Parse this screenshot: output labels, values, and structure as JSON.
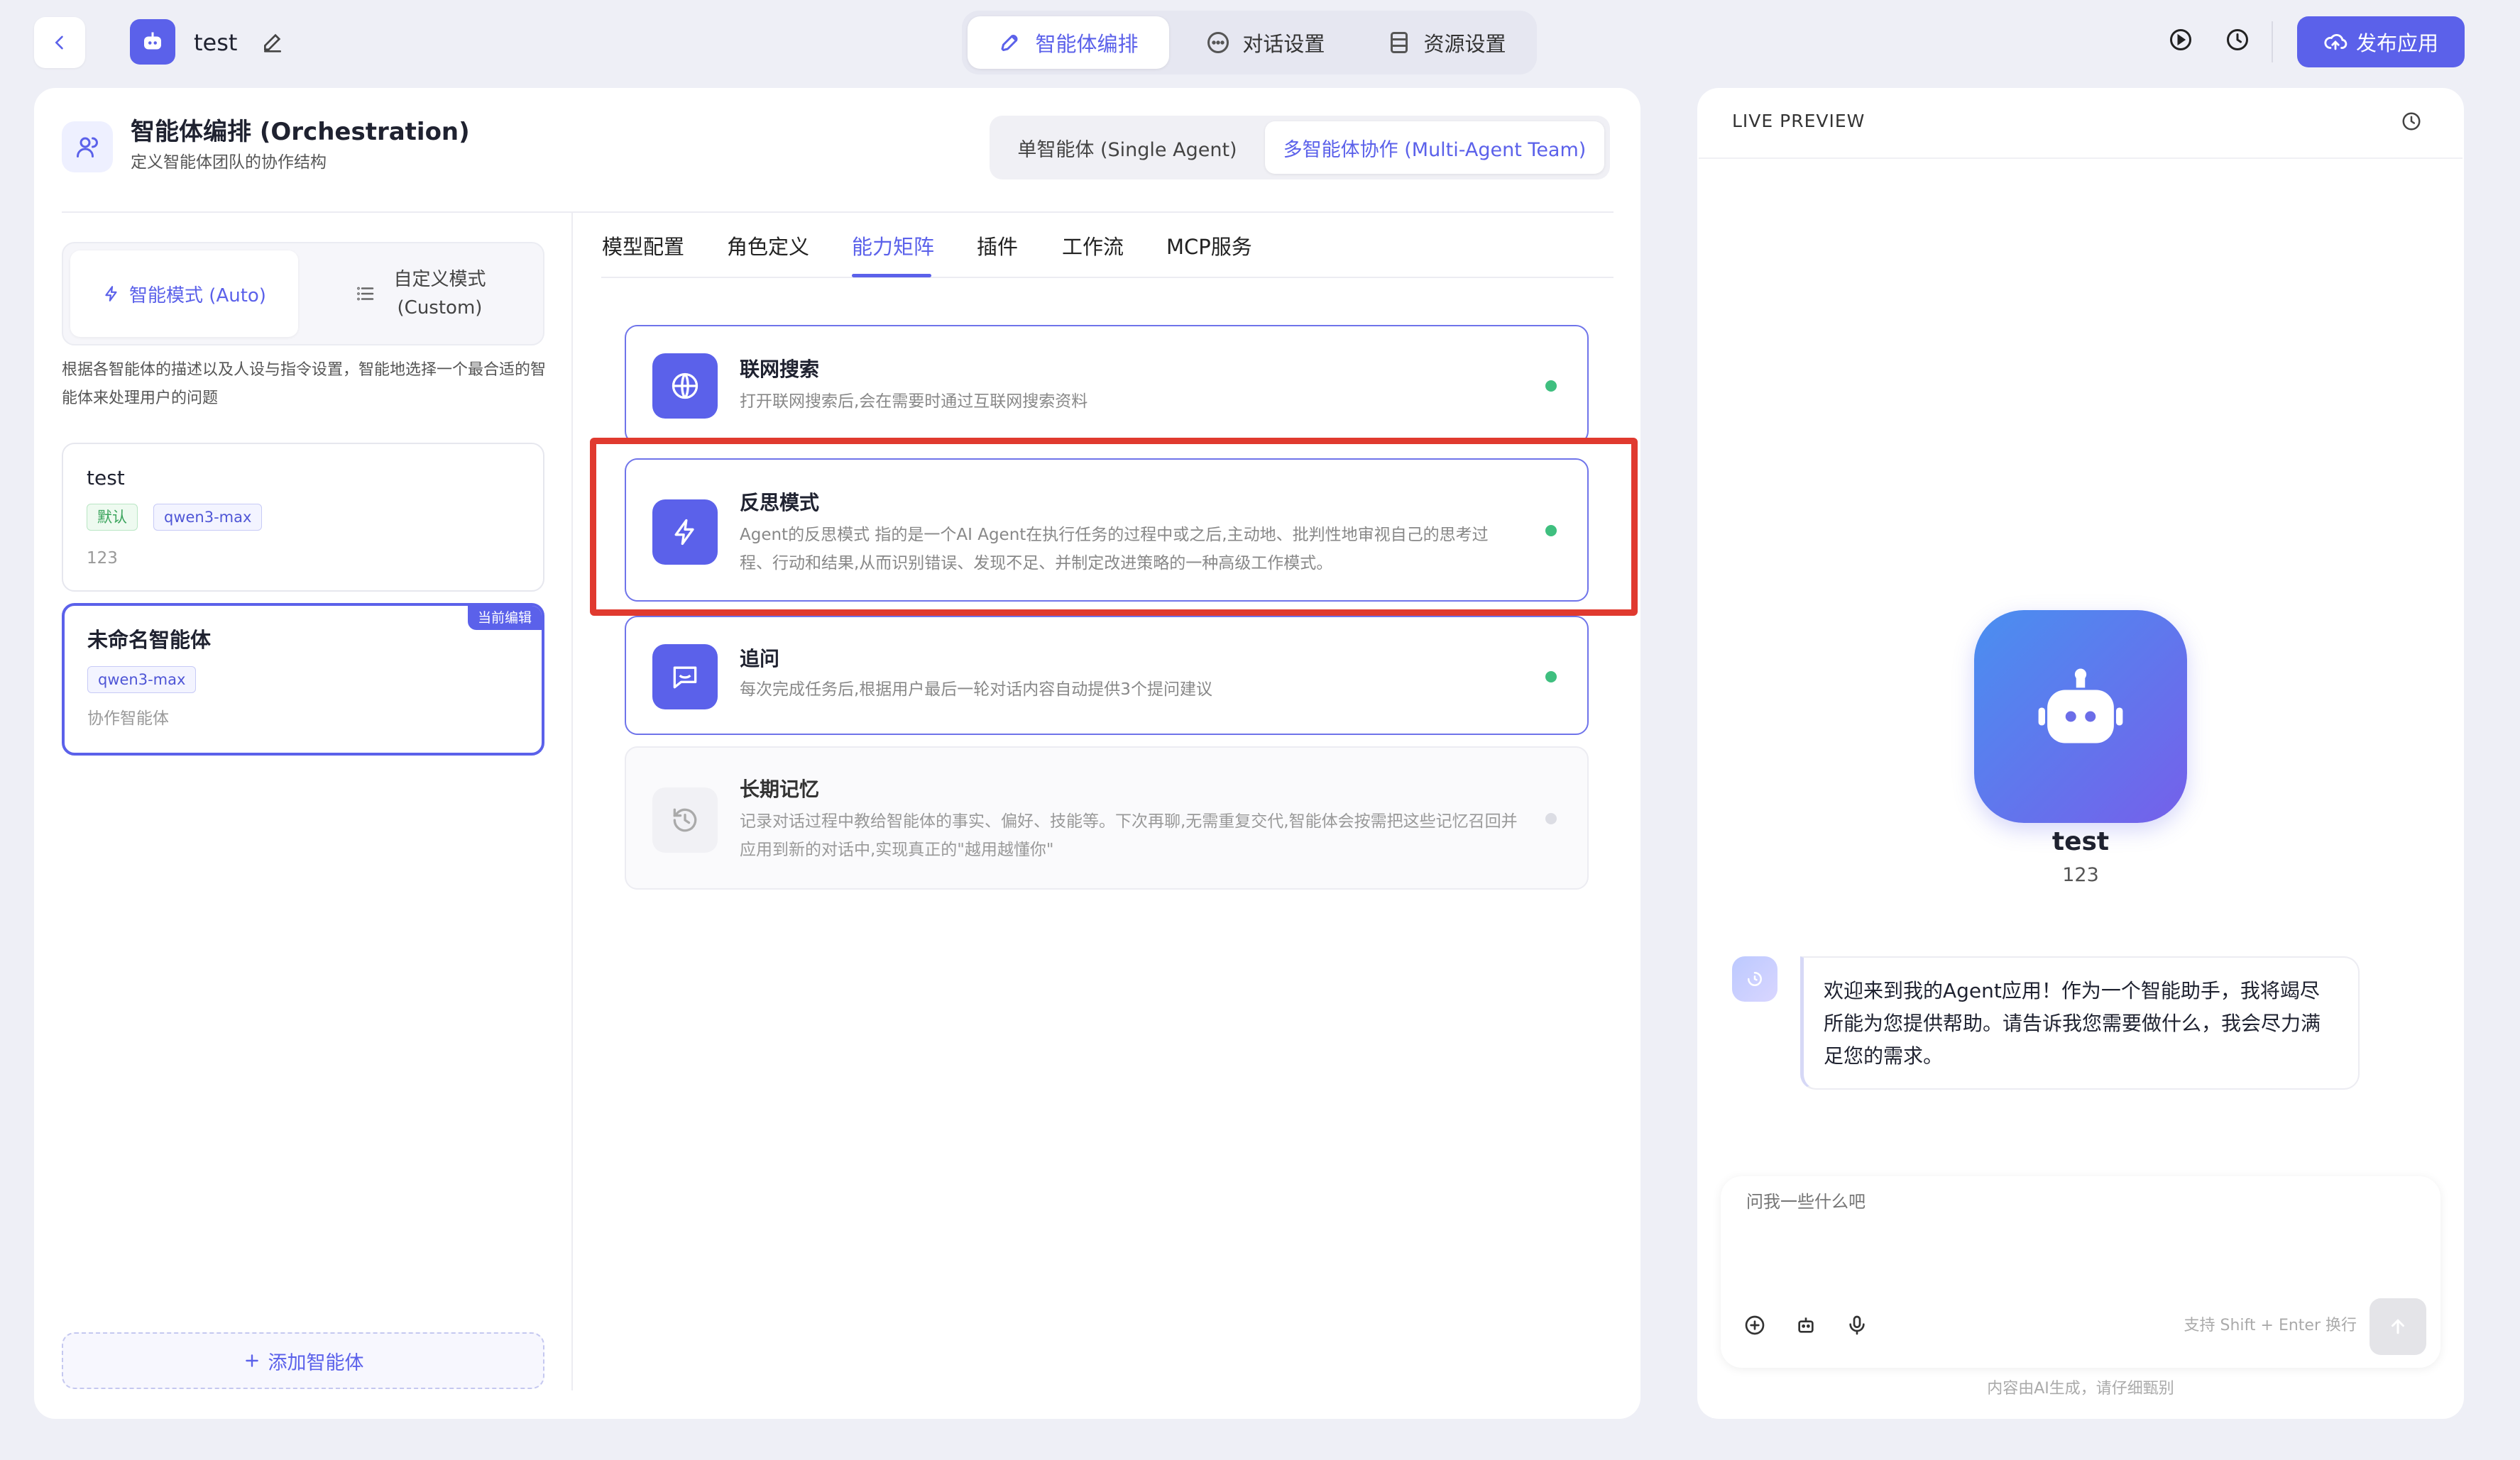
{
  "header": {
    "title": "test",
    "tabs": [
      {
        "label": "智能体编排",
        "active": true
      },
      {
        "label": "对话设置",
        "active": false
      },
      {
        "label": "资源设置",
        "active": false
      }
    ],
    "publish_label": "发布应用"
  },
  "orchestration": {
    "title": "智能体编排 (Orchestration)",
    "subtitle": "定义智能体团队的协作结构",
    "mode_toggle": {
      "single": "单智能体 (Single Agent)",
      "multi": "多智能体协作 (Multi-Agent Team)",
      "active": "multi"
    }
  },
  "left_panel": {
    "mode_auto": "智能模式 (Auto)",
    "mode_custom_line1": "自定义模式",
    "mode_custom_line2": "(Custom)",
    "description": "根据各智能体的描述以及人设与指令设置，智能地选择一个最合适的智能体来处理用户的问题",
    "agents": [
      {
        "name": "test",
        "tag_default": "默认",
        "model": "qwen3-max",
        "desc": "123"
      },
      {
        "name": "未命名智能体",
        "badge": "当前编辑",
        "model": "qwen3-max",
        "desc": "协作智能体"
      }
    ],
    "add_agent": "添加智能体"
  },
  "config_tabs": [
    {
      "label": "模型配置",
      "active": false
    },
    {
      "label": "角色定义",
      "active": false
    },
    {
      "label": "能力矩阵",
      "active": true
    },
    {
      "label": "插件",
      "active": false
    },
    {
      "label": "工作流",
      "active": false
    },
    {
      "label": "MCP服务",
      "active": false
    }
  ],
  "capabilities": [
    {
      "icon": "globe-icon",
      "title": "联网搜索",
      "desc": "打开联网搜索后,会在需要时通过互联网搜索资料",
      "enabled": true
    },
    {
      "icon": "lightning-icon",
      "title": "反思模式",
      "desc": "Agent的反思模式 指的是一个AI Agent在执行任务的过程中或之后,主动地、批判性地审视自己的思考过程、行动和结果,从而识别错误、发现不足、并制定改进策略的一种高级工作模式。",
      "enabled": true,
      "highlighted": true
    },
    {
      "icon": "chat-bubble-icon",
      "title": "追问",
      "desc": "每次完成任务后,根据用户最后一轮对话内容自动提供3个提问建议",
      "enabled": true
    },
    {
      "icon": "history-icon",
      "title": "长期记忆",
      "desc": "记录对话过程中教给智能体的事实、偏好、技能等。下次再聊,无需重复交代,智能体会按需把这些记忆召回并应用到新的对话中,实现真正的\"越用越懂你\"",
      "enabled": false
    }
  ],
  "preview": {
    "label": "LIVE PREVIEW",
    "agent_name": "test",
    "agent_desc": "123",
    "welcome": "欢迎来到我的Agent应用！作为一个智能助手，我将竭尽所能为您提供帮助。请告诉我您需要做什么，我会尽力满足您的需求。",
    "input_placeholder": "问我一些什么吧",
    "hint": "支持 Shift + Enter 换行",
    "footer": "内容由AI生成，请仔细甄别"
  },
  "colors": {
    "accent": "#5b61ea",
    "highlight": "#e03a2f",
    "enabled_dot": "#3fbf7f",
    "background": "#eeeff6"
  }
}
